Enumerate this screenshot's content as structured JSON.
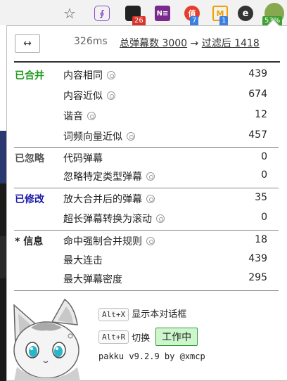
{
  "toolbar": {
    "star_glyph": "☆",
    "ext_a_glyph": "∮",
    "ext_c_glyph": "N≡",
    "ext_d_glyph": "值",
    "ext_e_glyph": "M",
    "ext_f_glyph": "e",
    "badges": {
      "b": "26",
      "d": "7",
      "e": "1",
      "g": "53%"
    }
  },
  "header": {
    "swap_glyph": "↔",
    "timing": "326ms",
    "total_label": "总弹幕数 3000",
    "arrow": "→",
    "filtered_label": "过滤后 1418"
  },
  "sections": {
    "merged": {
      "label": "已合并",
      "color": "#1d9a1d",
      "rows": [
        {
          "label": "内容相同",
          "value": "439"
        },
        {
          "label": "内容近似",
          "value": "674"
        },
        {
          "label": "谐音",
          "value": "12"
        },
        {
          "label": "词频向量近似",
          "value": "457"
        }
      ]
    },
    "ignored": {
      "label": "已忽略",
      "color": "#555555",
      "rows": [
        {
          "label": "代码弹幕",
          "value": "0"
        },
        {
          "label": "忽略特定类型弹幕",
          "value": "0"
        }
      ]
    },
    "modified": {
      "label": "已修改",
      "color": "#1a1aa8",
      "rows": [
        {
          "label": "放大合并后的弹幕",
          "value": "35"
        },
        {
          "label": "超长弹幕转换为滚动",
          "value": "0"
        }
      ]
    },
    "info": {
      "label": "* 信息",
      "color": "#222222",
      "rows": [
        {
          "label": "命中强制合并规则",
          "value": "18"
        },
        {
          "label": "最大连击",
          "value": "439"
        },
        {
          "label": "最大弹幕密度",
          "value": "295"
        }
      ]
    }
  },
  "footer": {
    "kbd_show": "Alt+X",
    "show_text": "显示本对话框",
    "kbd_toggle": "Alt+R",
    "toggle_text": "切换",
    "working_button": "工作中",
    "version": "pakku v9.2.9 by @xmcp"
  }
}
